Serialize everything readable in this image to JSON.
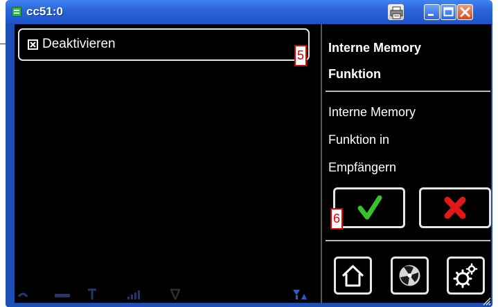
{
  "window": {
    "title": "cc51:0",
    "icons": [
      "app-icon",
      "print-icon",
      "minimize-icon",
      "maximize-icon",
      "close-icon"
    ]
  },
  "option": {
    "label": "Deaktivieren",
    "checked": true
  },
  "markers": {
    "option": "5",
    "confirm": "6"
  },
  "panel": {
    "title_line1": "Interne Memory",
    "title_line2": "Funktion",
    "desc_line1": "Interne Memory",
    "desc_line2": "Funktion in",
    "desc_line3": "Empfängern"
  },
  "buttons": {
    "confirm_icon": "checkmark-icon",
    "cancel_icon": "x-icon"
  },
  "nav": [
    "home-icon",
    "fan-icon",
    "gear-icon"
  ],
  "colors": {
    "titlebar": "#2b63d8",
    "screen_bg": "#000000",
    "check_green": "#37c12a",
    "cancel_red": "#e01818",
    "marker_red": "#e00000",
    "status_blue": "#2a5bd1"
  }
}
